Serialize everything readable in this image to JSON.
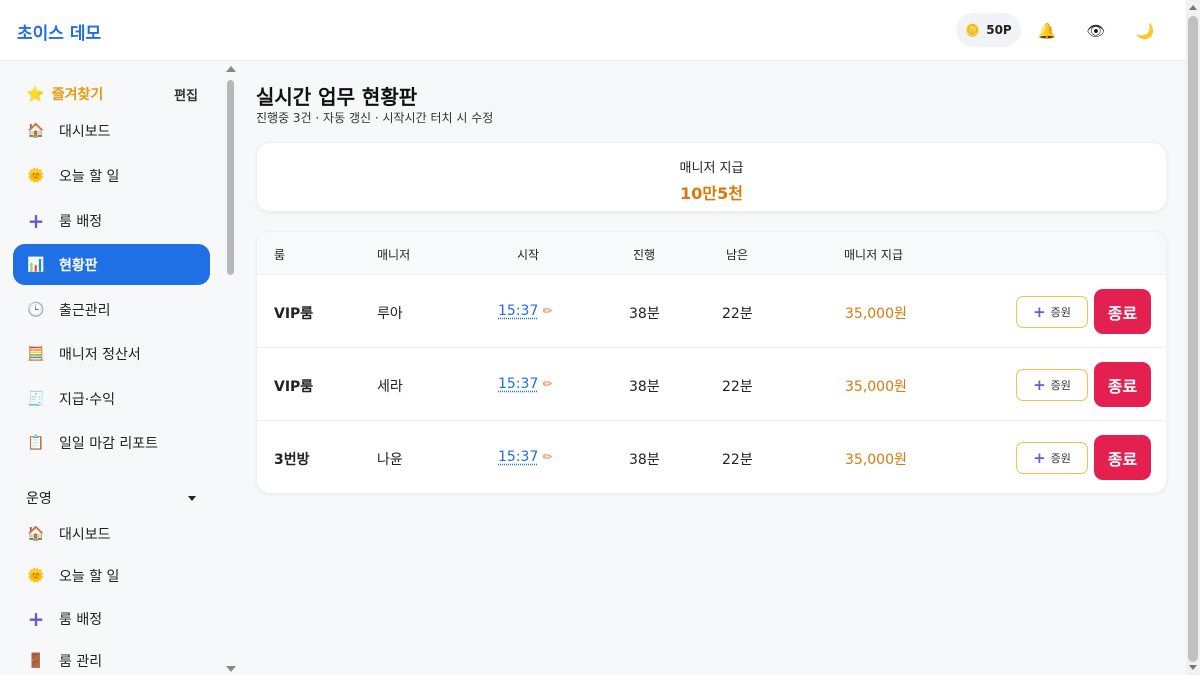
{
  "header": {
    "brand": "초이스 데모",
    "points": "50P",
    "icons": [
      "bell-icon",
      "eye-icon",
      "moon-icon"
    ]
  },
  "sidebar": {
    "favorites": {
      "title": "즐겨찾기",
      "edit_label": "편집",
      "items": [
        {
          "label": "대시보드",
          "icon": "house-icon"
        },
        {
          "label": "오늘 할 일",
          "icon": "sun-icon"
        },
        {
          "label": "룸 배정",
          "icon": "plus-icon"
        },
        {
          "label": "현황판",
          "icon": "chart-icon",
          "active": true
        },
        {
          "label": "출근관리",
          "icon": "clock-icon"
        },
        {
          "label": "매니저 정산서",
          "icon": "abacus-icon"
        },
        {
          "label": "지급·수익",
          "icon": "receipt-icon"
        },
        {
          "label": "일일 마감 리포트",
          "icon": "clipboard-icon"
        }
      ]
    },
    "operations": {
      "title": "운영",
      "items": [
        {
          "label": "대시보드",
          "icon": "house-icon"
        },
        {
          "label": "오늘 할 일",
          "icon": "sun-icon"
        },
        {
          "label": "룸 배정",
          "icon": "plus-icon"
        },
        {
          "label": "룸 관리",
          "icon": "door-icon"
        }
      ]
    }
  },
  "main": {
    "title": "실시간 업무 현황판",
    "subtitle": "진행중 3건 · 자동 갱신 · 시작시간 터치 시 수정",
    "manager_pay": {
      "label": "매니저 지급",
      "value": "10만5천"
    },
    "table": {
      "columns": {
        "room": "룸",
        "manager": "매니저",
        "start": "시작",
        "elapsed": "진행",
        "remaining": "남은",
        "pay": "매니저 지급"
      },
      "gift_label": "증원",
      "end_label": "종료",
      "rows": [
        {
          "room": "VIP룸",
          "manager": "루아",
          "start": "15:37",
          "elapsed": "38분",
          "remaining": "22분",
          "pay": "35,000원"
        },
        {
          "room": "VIP룸",
          "manager": "세라",
          "start": "15:37",
          "elapsed": "38분",
          "remaining": "22분",
          "pay": "35,000원"
        },
        {
          "room": "3번방",
          "manager": "나윤",
          "start": "15:37",
          "elapsed": "38분",
          "remaining": "22분",
          "pay": "35,000원"
        }
      ]
    }
  },
  "colors": {
    "accent": "#1f6fe5",
    "pay": "#d9780b",
    "danger": "#e3204f",
    "favorite": "#e89a0e"
  }
}
